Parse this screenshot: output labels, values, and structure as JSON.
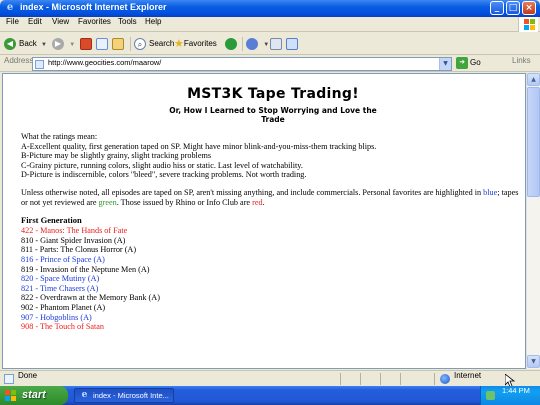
{
  "window": {
    "title": "index - Microsoft Internet Explorer",
    "controls": {
      "minimize": "_",
      "maximize": "□",
      "close": "×"
    }
  },
  "menu": [
    "File",
    "Edit",
    "View",
    "Favorites",
    "Tools",
    "Help"
  ],
  "toolbar": {
    "back_label": "Back",
    "search_label": "Search",
    "favorites_label": "Favorites"
  },
  "address": {
    "label": "Address",
    "url": "http://www.geocities.com/maarow/",
    "go_label": "Go",
    "links_label": "Links"
  },
  "page": {
    "title": "MST3K Tape Trading!",
    "subtitle": "Or, How I Learned to Stop Worrying and Love the Trade",
    "ratings_intro": "What the ratings mean:",
    "ratings": [
      "A-Excellent quality, first generation taped on SP.  Might have minor blink-and-you-miss-them tracking blips.",
      "B-Picture may be slightly grainy, slight tracking problems",
      "C-Grainy picture, running colors, slight audio hiss or static.  Last level of watchability.",
      "D-Picture is indiscernible, colors \"bleed\", severe tracking problems.  Not worth trading."
    ],
    "note": {
      "part1": "Unless otherwise noted, all episodes are taped on SP, aren't missing anything, and include commercials. Personal favorites are highlighted in ",
      "blue_word": "blue",
      "part2": "; tapes or not yet reviewed are ",
      "green_word": "green",
      "part3": ".  Those issued by Rhino or Info Club are ",
      "red_word": "red",
      "part4": "."
    },
    "section_title": "First Generation",
    "episodes": [
      {
        "text": "422 - Manos: The Hands of Fate",
        "color": "red"
      },
      {
        "text": "810 - Giant Spider Invasion (A)",
        "color": "black"
      },
      {
        "text": "811 - Parts: The Clonus Horror (A)",
        "color": "black"
      },
      {
        "text": "816 - Prince of Space (A)",
        "color": "blue"
      },
      {
        "text": "819 - Invasion of the Neptune Men (A)",
        "color": "black"
      },
      {
        "text": "820 - Space Mutiny (A)",
        "color": "blue"
      },
      {
        "text": "821 - Time Chasers (A)",
        "color": "blue"
      },
      {
        "text": "822 - Overdrawn at the Memory Bank (A)",
        "color": "black"
      },
      {
        "text": "902 - Phantom Planet (A)",
        "color": "black"
      },
      {
        "text": "907 - Hobgoblins (A)",
        "color": "blue"
      },
      {
        "text": "908 - The Touch of Satan",
        "color": "red"
      }
    ]
  },
  "status": {
    "text": "Done",
    "zone": "Internet"
  },
  "taskbar": {
    "start_label": "start",
    "task_label": "index - Microsoft Inte...",
    "clock": "1:44 PM"
  },
  "colors": {
    "link_blue": "#1a3ad8",
    "highlight_red": "#ee1c1c",
    "green": "#2e9a2e",
    "xp_blue": "#0a5ce0"
  }
}
